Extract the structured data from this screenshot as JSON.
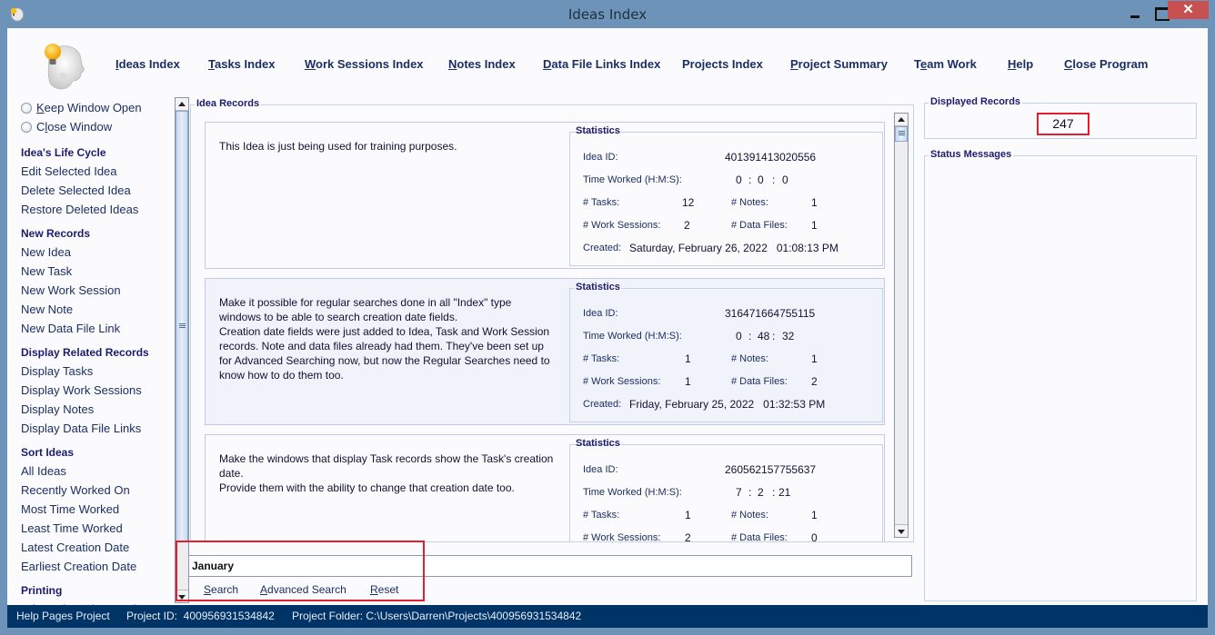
{
  "window": {
    "title": "Ideas Index",
    "close_symbol": "✕"
  },
  "topnav": [
    {
      "key": "I",
      "rest": "deas Index",
      "label": "Ideas Index"
    },
    {
      "key": "T",
      "rest": "asks Index",
      "label": "Tasks Index"
    },
    {
      "key": "W",
      "rest": "ork Sessions Index",
      "label": "Work Sessions Index"
    },
    {
      "key": "N",
      "rest": "otes Index",
      "label": "Notes Index"
    },
    {
      "key": "D",
      "rest": "ata File Links Index",
      "label": "Data File Links Index"
    },
    {
      "key": "",
      "rest": "Projects Index",
      "label": "Projects Index"
    },
    {
      "key": "P",
      "rest": "roject Summary",
      "label": "Project Summary"
    },
    {
      "key": "T",
      "pre": "",
      "rest": "eam Work",
      "label": "Team Work"
    },
    {
      "key": "H",
      "rest": "elp",
      "label": "Help"
    },
    {
      "key": "C",
      "rest": "lose Program",
      "label": "Close Program"
    }
  ],
  "sidebar": {
    "radios": [
      {
        "label": "Keep Window Open",
        "selected": false
      },
      {
        "label": "Close Window",
        "selected": false
      }
    ],
    "sections": [
      {
        "title": "Idea's Life Cycle",
        "items": [
          "Edit Selected Idea",
          "Delete Selected Idea",
          "Restore Deleted Ideas"
        ]
      },
      {
        "title": "New Records",
        "items": [
          "New Idea",
          "New Task",
          "New Work Session",
          "New Note",
          "New Data File Link"
        ]
      },
      {
        "title": "Display Related Records",
        "items": [
          "Display Tasks",
          "Display Work Sessions",
          "Display Notes",
          "Display Data File Links"
        ]
      },
      {
        "title": "Sort Ideas",
        "items": [
          "All Ideas",
          "Recently Worked On",
          "Most Time Worked",
          "Least Time Worked",
          "Latest Creation Date",
          "Earliest Creation Date"
        ]
      },
      {
        "title": "Printing",
        "items": [
          "Print Selected Record"
        ]
      }
    ]
  },
  "records_panel": {
    "title": "Idea Records",
    "stat_labels": {
      "group": "Statistics",
      "idea_id": "Idea ID:",
      "time_worked": "Time Worked (H:M:S):",
      "tasks": "# Tasks:",
      "notes": "# Notes:",
      "work_sessions": "# Work Sessions:",
      "data_files": "# Data Files:",
      "created": "Created:"
    },
    "records": [
      {
        "description": "This Idea is just being used for training purposes.",
        "idea_id": "401391413020556",
        "time": {
          "h": "0",
          "m": "0",
          "s": "0"
        },
        "tasks": "12",
        "notes": "1",
        "work_sessions": "2",
        "data_files": "1",
        "created": "Saturday, February 26, 2022   01:08:13 PM",
        "selected": false
      },
      {
        "description": "Make it possible for regular searches done in all \"Index\" type windows to be able to search creation date fields.\nCreation date fields were just added to Idea, Task and Work Session records. Note and data files already had them. They've been set up for Advanced Searching now, but now the Regular Searches need to know how to do them too.",
        "idea_id": "316471664755115",
        "time": {
          "h": "0",
          "m": "48",
          "s": "32"
        },
        "tasks": "1",
        "notes": "1",
        "work_sessions": "1",
        "data_files": "2",
        "created": "Friday, February 25, 2022   01:32:53 PM",
        "selected": true
      },
      {
        "description": "Make the windows that display Task records show the Task's creation date.\nProvide them with the ability to change that creation date too.",
        "idea_id": "260562157755637",
        "time": {
          "h": "7",
          "m": "2",
          "s": "21"
        },
        "tasks": "1",
        "notes": "1",
        "work_sessions": "2",
        "data_files": "0",
        "created": "",
        "selected": false
      }
    ]
  },
  "search": {
    "value": "January",
    "buttons": [
      {
        "key": "S",
        "rest": "earch"
      },
      {
        "key": "A",
        "rest": "dvanced Search"
      },
      {
        "key": "R",
        "rest": "eset"
      }
    ]
  },
  "right_panel": {
    "displayed_records_title": "Displayed Records",
    "displayed_records_count": "247",
    "status_messages_title": "Status Messages"
  },
  "statusbar": {
    "project_name": "Help Pages Project",
    "project_id": "Project ID:  400956931534842",
    "project_folder": "Project Folder: C:\\Users\\Darren\\Projects\\400956931534842"
  },
  "colors": {
    "titlebar": "#6d94b8",
    "statusbar": "#003366",
    "link_text": "#1c2f63",
    "heading_text": "#1c1c6e",
    "highlight_box": "#e02030",
    "selected_record_bg": "#f1f3fb"
  }
}
